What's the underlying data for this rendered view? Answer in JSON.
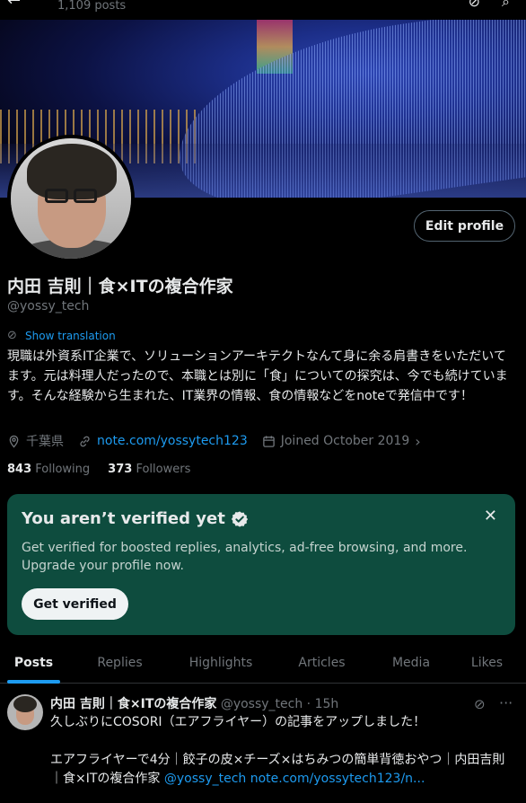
{
  "topbar": {
    "posts_count": "1,109 posts"
  },
  "profile": {
    "edit_label": "Edit profile",
    "name": "内田 吉則｜食×ITの複合作家",
    "handle": "@yossy_tech",
    "translate_label": "Show translation",
    "bio": "現職は外資系IT企業で、ソリューションアーキテクトなんて身に余る肩書きをいただいてます。元は料理人だったので、本職とは別に「食」についての探究は、今でも続けています。そんな経験から生まれた、IT業界の情報、食の情報などをnoteで発信中です！",
    "location": "千葉県",
    "link": "note.com/yossytech123",
    "joined": "Joined October 2019",
    "following_count": "843",
    "following_label": "Following",
    "followers_count": "373",
    "followers_label": "Followers"
  },
  "verify": {
    "title": "You aren’t verified yet",
    "desc": "Get verified for boosted replies, analytics, ad-free browsing, and more. Upgrade your profile now.",
    "button": "Get verified",
    "close": "✕"
  },
  "tabs": [
    {
      "label": "Posts",
      "active": true
    },
    {
      "label": "Replies"
    },
    {
      "label": "Highlights"
    },
    {
      "label": "Articles"
    },
    {
      "label": "Media"
    },
    {
      "label": "Likes"
    }
  ],
  "post": {
    "author": "内田 吉則｜食×ITの複合作家",
    "handle": "@yossy_tech",
    "time": "15h",
    "line1": "久しぶりにCOSORI（エアフライヤー）の記事をアップしました！",
    "line2": "エアフライヤーで4分｜餃子の皮×チーズ×はちみつの簡単背徳おやつ｜内田吉則 ｜食×ITの複合作家",
    "mention": "@yossy_tech",
    "link": "note.com/yossytech123/n..."
  },
  "colors": {
    "accent": "#1d9bf0",
    "card": "#0e4c3e",
    "muted": "#71767b"
  }
}
